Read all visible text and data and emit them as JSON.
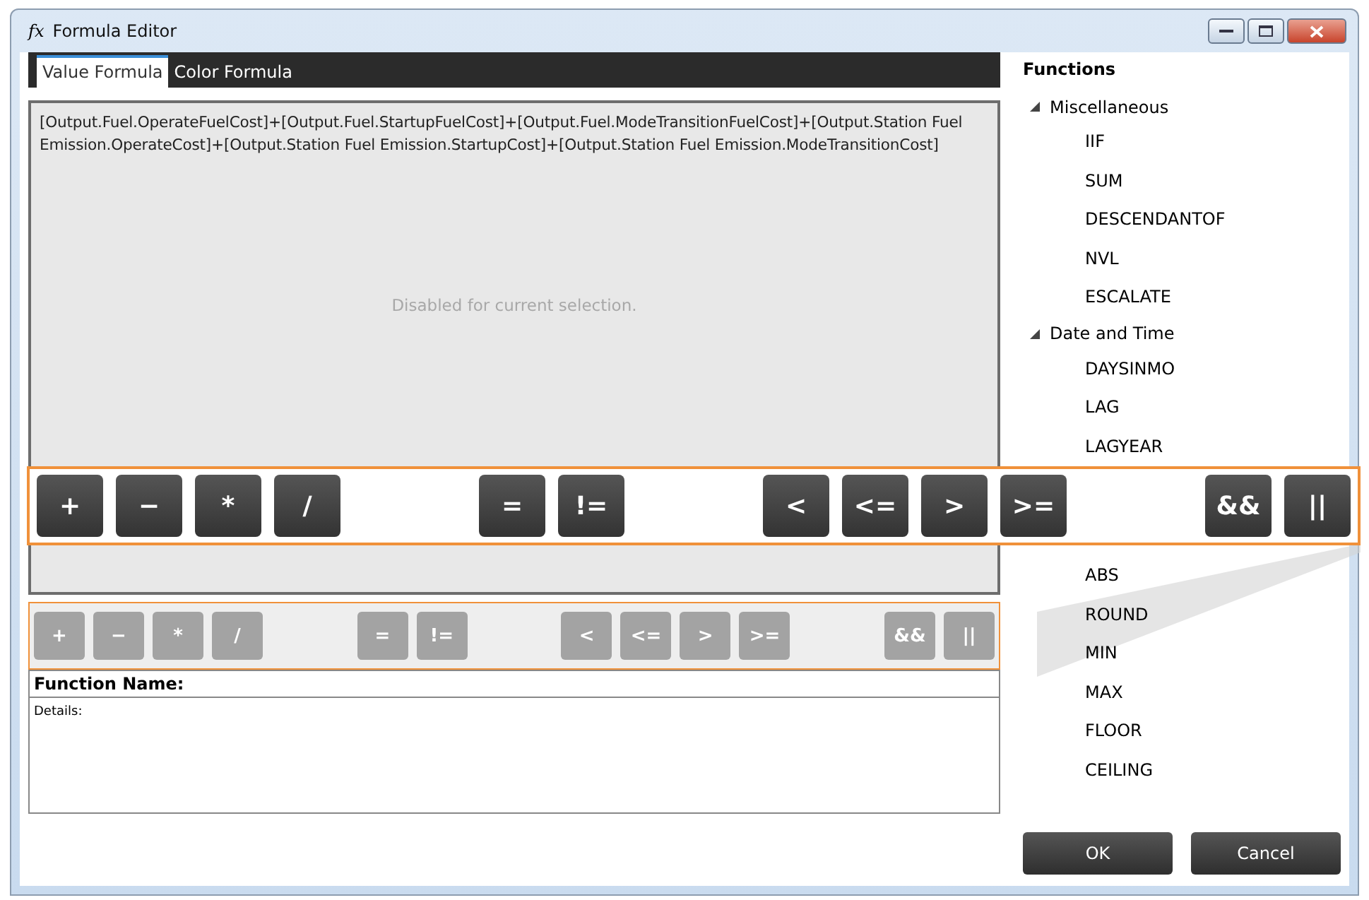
{
  "window": {
    "icon_text": "fx",
    "title": "Formula Editor"
  },
  "tabs": [
    {
      "label": "Value Formula",
      "selected": true
    },
    {
      "label": "Color Formula",
      "selected": false
    }
  ],
  "editor": {
    "disabled": true,
    "value": "[Output.Fuel.OperateFuelCost]+[Output.Fuel.StartupFuelCost]+[Output.Fuel.ModeTransitionFuelCost]+[Output.Station Fuel Emission.OperateCost]+[Output.Station Fuel Emission.StartupCost]+[Output.Station Fuel Emission.ModeTransitionCost]",
    "status": "Disabled for current selection."
  },
  "toolbar": {
    "disabled": true,
    "groups": [
      {
        "buttons": [
          "+",
          "−",
          "*",
          "/"
        ]
      },
      {
        "buttons": [
          "=",
          "!="
        ]
      },
      {
        "buttons": [
          "<",
          "<=",
          ">",
          ">="
        ]
      },
      {
        "buttons": [
          "&&",
          "||"
        ]
      }
    ]
  },
  "details": {
    "function_name_label": "Function Name:",
    "details_label": "Details:"
  },
  "functions": {
    "title": "Functions",
    "categories": [
      {
        "label": "Miscellaneous",
        "expanded": true,
        "children": [
          "IIF",
          "SUM",
          "DESCENDANTOF",
          "NVL",
          "ESCALATE"
        ]
      },
      {
        "label": "Date and Time",
        "expanded": true,
        "children": [
          "DAYSINMO",
          "LAG",
          "LAGYEAR"
        ]
      },
      {
        "children": [
          "ABS",
          "ROUND",
          "MIN",
          "MAX",
          "FLOOR",
          "CEILING"
        ]
      }
    ]
  },
  "callout": {
    "groups": [
      {
        "buttons": [
          "+",
          "−",
          "*",
          "/"
        ]
      },
      {
        "buttons": [
          "=",
          "!="
        ]
      },
      {
        "buttons": [
          "<",
          "<=",
          ">",
          ">="
        ]
      },
      {
        "buttons": [
          "&&",
          "||"
        ]
      }
    ]
  },
  "buttons": [
    "OK",
    "Cancel"
  ]
}
